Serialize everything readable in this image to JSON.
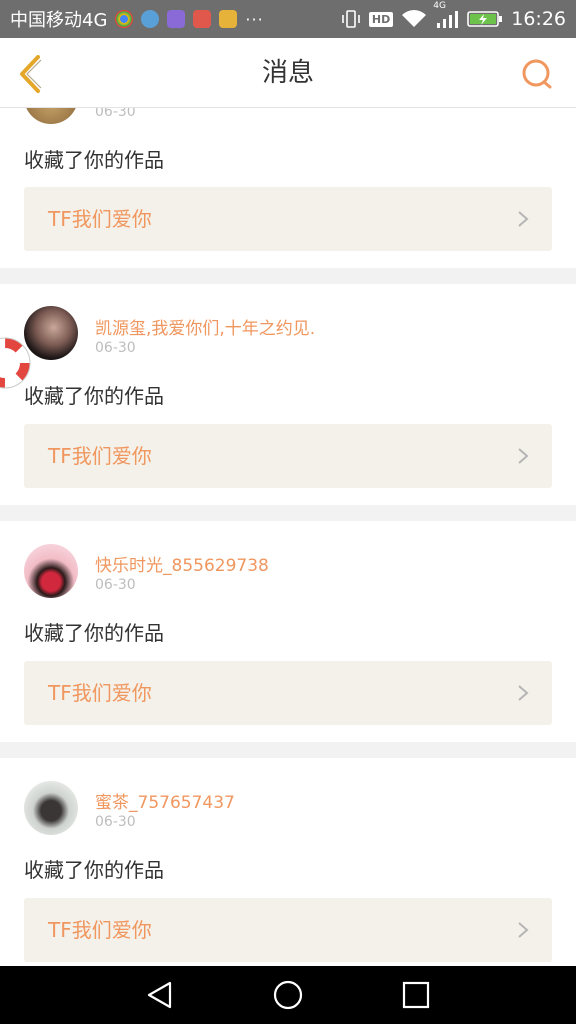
{
  "status_bar": {
    "carrier": "中国移动4G",
    "ellipsis": "···",
    "time": "16:26",
    "network": "4G",
    "hd": "HD"
  },
  "header": {
    "title": "消息",
    "back_icon": "chevron-left-icon",
    "search_icon": "search-icon"
  },
  "messages": [
    {
      "user": "",
      "date": "06-30",
      "action": "收藏了你的作品",
      "work": "TF我们爱你"
    },
    {
      "user": "凯源玺,我爱你们,十年之约见.",
      "date": "06-30",
      "action": "收藏了你的作品",
      "work": "TF我们爱你"
    },
    {
      "user": "快乐时光_855629738",
      "date": "06-30",
      "action": "收藏了你的作品",
      "work": "TF我们爱你"
    },
    {
      "user": "蜜茶_757657437",
      "date": "06-30",
      "action": "收藏了你的作品",
      "work": "TF我们爱你"
    }
  ],
  "colors": {
    "accent": "#f0975f",
    "work_bg": "#f4f1ea",
    "separator": "#f2f2f2",
    "status_bar": "#6e6e6e"
  },
  "nav_bar": {
    "back_icon": "triangle-back-icon",
    "home_icon": "circle-home-icon",
    "recents_icon": "square-recents-icon"
  }
}
